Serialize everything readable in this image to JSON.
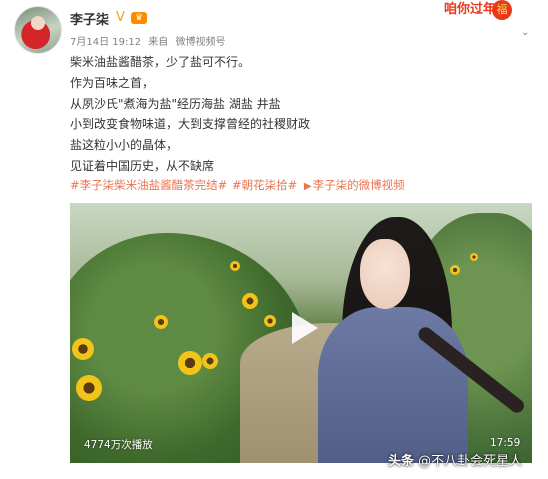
{
  "post": {
    "username": "李子柒",
    "badges": {
      "verified_icon": "v-icon",
      "member_icon": "crown-icon"
    },
    "festival_badge": "咱你过年",
    "meta": {
      "date": "7月14日 19:12",
      "from_label": "来自",
      "source": "微博视频号"
    },
    "text_lines": [
      "柴米油盐酱醋茶，少了盐可不行。",
      "作为百味之首，",
      "从夙沙氏\"煮海为盐\"经历海盐 湖盐 井盐",
      "小到改变食物味道，大到支撑曾经的社稷财政",
      "盐这粒小小的晶体，",
      "见证着中国历史，从不缺席"
    ],
    "tags": [
      "#李子柒柴米油盐酱醋茶完结#",
      "#朝花柒拾#"
    ],
    "video_link": {
      "icon": "video-link-icon",
      "label": "李子柒的微博视频"
    },
    "video": {
      "view_count": "4774万次播放",
      "duration": "17:59",
      "play_icon": "play-icon"
    }
  },
  "watermark": {
    "brand": "头条",
    "handle": "@不八卦会死星人"
  },
  "colors": {
    "link": "#eb7350",
    "meta": "#808080",
    "text": "#333333",
    "festival": "#e8391a"
  }
}
